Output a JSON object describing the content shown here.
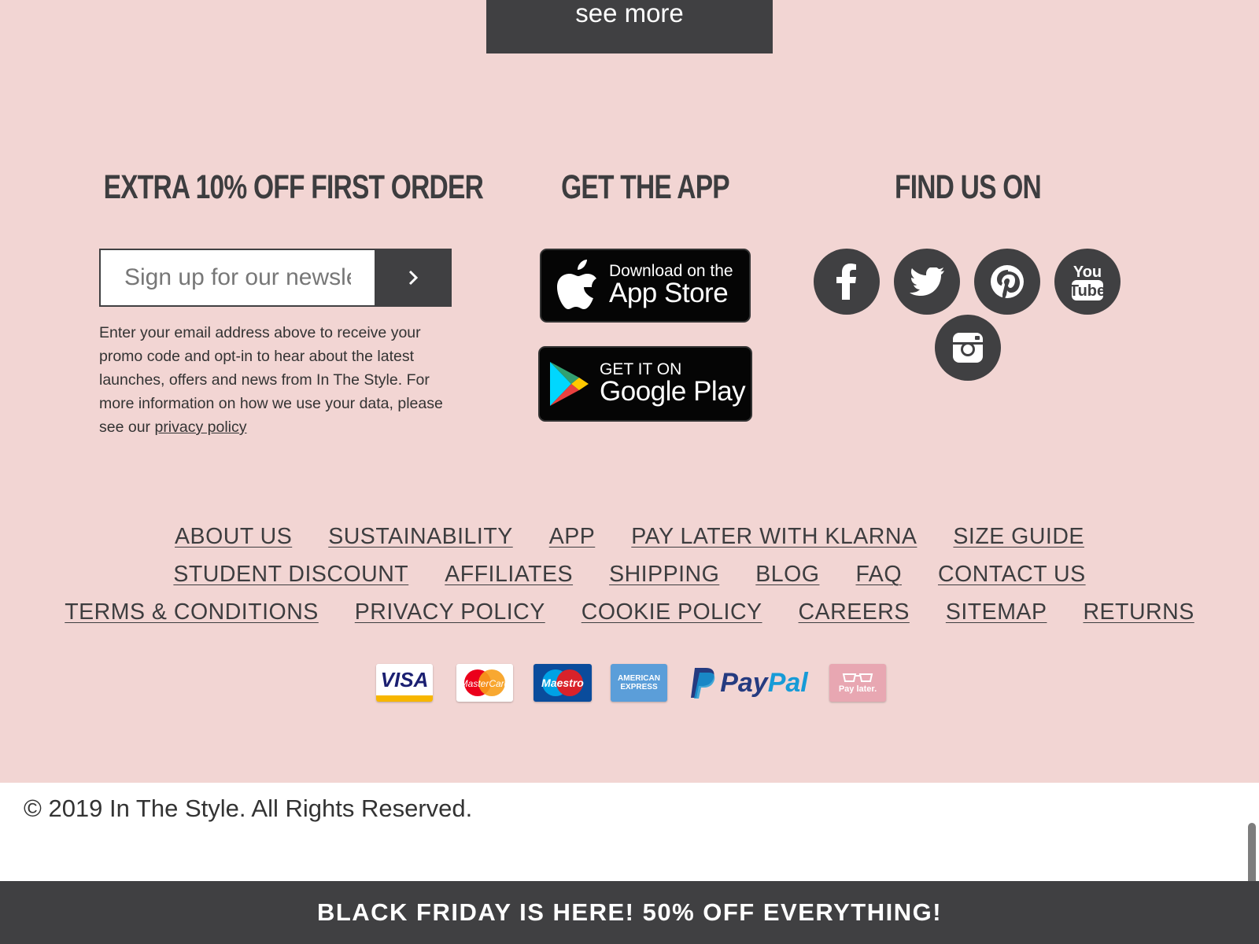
{
  "top": {
    "see_more_label": "see more"
  },
  "newsletter": {
    "heading": "EXTRA 10% OFF FIRST ORDER",
    "placeholder": "Sign up for our newsletter",
    "disclaimer_text": "Enter your email address above to receive your promo code and opt-in to hear about the latest launches, offers and news from In The Style. For more information on how we use your data, please see our ",
    "privacy_link": "privacy policy"
  },
  "app": {
    "heading": "GET THE APP",
    "app_store_small": "Download on the",
    "app_store_big": "App Store",
    "google_small": "GET IT ON",
    "google_big": "Google Play"
  },
  "social": {
    "heading": "FIND US ON",
    "youtube_top": "You",
    "youtube_bottom": "Tube"
  },
  "footer_links": {
    "row1": [
      "ABOUT US",
      "SUSTAINABILITY",
      "APP",
      "PAY LATER WITH KLARNA",
      "SIZE GUIDE"
    ],
    "row2": [
      "STUDENT DISCOUNT",
      "AFFILIATES",
      "SHIPPING",
      "BLOG",
      "FAQ",
      "CONTACT US"
    ],
    "row3": [
      "TERMS & CONDITIONS",
      "PRIVACY POLICY",
      "COOKIE POLICY",
      "CAREERS",
      "SITEMAP",
      "RETURNS"
    ]
  },
  "payments": {
    "visa": "VISA",
    "mastercard": "MasterCard",
    "maestro": "Maestro",
    "amex": "AMERICAN EXPRESS",
    "paypal_pay": "Pay",
    "paypal_pal": "Pal",
    "klarna": "Pay later."
  },
  "copyright": "© 2019 In The Style. All Rights Reserved.",
  "banner": "BLACK FRIDAY IS HERE! 50% OFF EVERYTHING!",
  "colors": {
    "background_pink": "#f2d5d3",
    "dark_gray": "#404042",
    "paypal_dark": "#253b80",
    "paypal_light": "#179bd7",
    "klarna_pink": "#e8a7b2"
  }
}
